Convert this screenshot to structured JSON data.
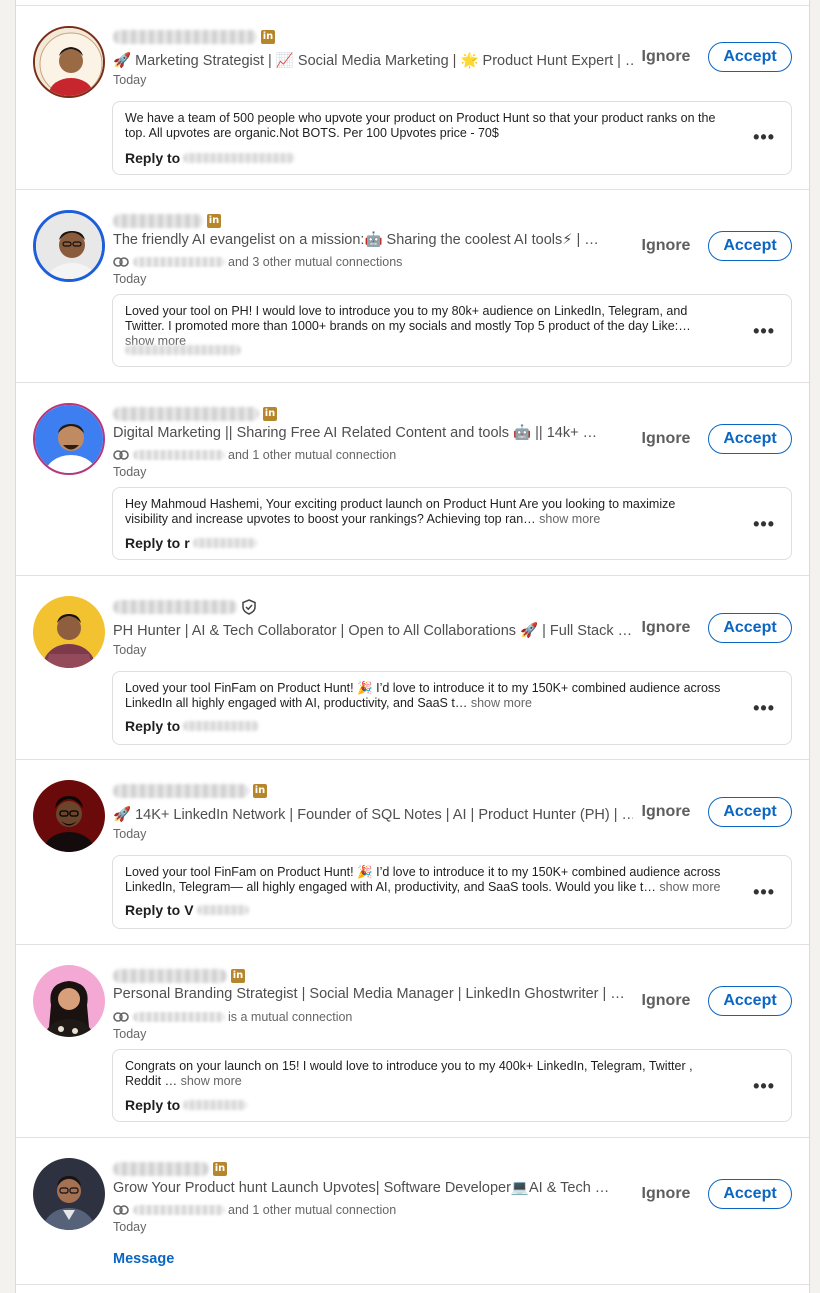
{
  "buttons": {
    "ignore": "Ignore",
    "accept": "Accept",
    "reply_prefix": "Reply to",
    "message": "Message",
    "more": "•••"
  },
  "colors": {
    "accent": "#0a66c2",
    "badge": "#b7862b"
  },
  "invitations": [
    {
      "headline": "🚀 Marketing Strategist | 📈 Social Media Marketing | 🌟 Product Hunt Expert | …",
      "time": "Today",
      "badge": "in",
      "message": "We have a team of 500 people who upvote your product on Product Hunt so that your product ranks on the top. All upvotes are organic.Not BOTS. Per 100 Upvotes price - 70$",
      "reply_initial": ""
    },
    {
      "headline": "The friendly AI evangelist on a mission:🤖 Sharing the coolest AI tools⚡ | …",
      "mutual": "and 3 other mutual connections",
      "time": "Today",
      "badge": "in",
      "message": "Loved your tool on PH! I would love to introduce you to my 80k+ audience on LinkedIn, Telegram, and Twitter. I promoted more than 1000+ brands on my socials and mostly Top 5 product of the day Like:…",
      "show_more": "show more"
    },
    {
      "headline": "Digital Marketing || Sharing Free AI Related Content and tools 🤖  || 14k+ …",
      "mutual": "and 1 other mutual connection",
      "time": "Today",
      "badge": "in",
      "message": "Hey Mahmoud Hashemi, Your exciting product launch on Product Hunt Are you looking to maximize visibility and increase upvotes to boost your rankings? Achieving top ran…",
      "show_more": "show more",
      "reply_initial": "r"
    },
    {
      "headline": "PH Hunter | AI & Tech Collaborator | Open to All Collaborations 🚀 | Full Stack …",
      "time": "Today",
      "message": "Loved your tool FinFam on Product Hunt! 🎉 I’d love to introduce it to my 150K+ combined audience across LinkedIn all highly engaged with AI, productivity, and SaaS t…",
      "show_more": "show more",
      "reply_initial": ""
    },
    {
      "headline": "🚀 14K+ LinkedIn Network | Founder of SQL Notes | AI | Product Hunter (PH) | …",
      "time": "Today",
      "badge": "in",
      "message": "Loved your tool FinFam on Product Hunt! 🎉 I’d love to introduce it to my 150K+ combined audience across LinkedIn, Telegram— all highly engaged with AI, productivity, and SaaS tools. Would you like t…",
      "show_more": "show more",
      "reply_initial": "V"
    },
    {
      "headline": "Personal Branding Strategist | Social Media Manager | LinkedIn Ghostwriter | …",
      "mutual": "is a mutual connection",
      "time": "Today",
      "badge": "in",
      "message": "Congrats on your launch on 15! I would love to introduce you to my 400k+ LinkedIn, Telegram, Twitter , Reddit …",
      "show_more": "show more",
      "reply_initial": ""
    },
    {
      "headline": "Grow Your Product hunt Launch Upvotes| Software Developer💻AI & Tech …",
      "mutual": "and 1 other mutual connection",
      "time": "Today",
      "badge": "in"
    }
  ]
}
